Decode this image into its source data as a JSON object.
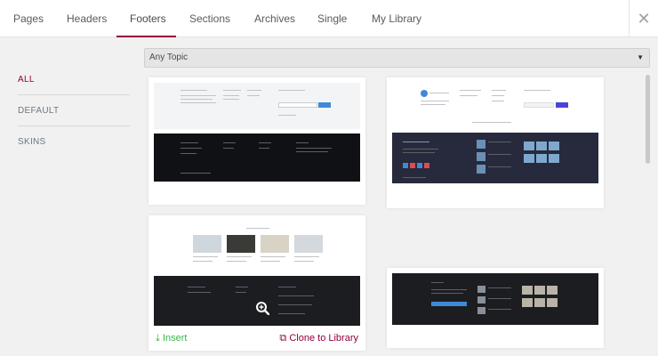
{
  "tabs": [
    {
      "label": "Pages"
    },
    {
      "label": "Headers"
    },
    {
      "label": "Footers"
    },
    {
      "label": "Sections"
    },
    {
      "label": "Archives"
    },
    {
      "label": "Single"
    },
    {
      "label": "My Library"
    }
  ],
  "active_tab": "Footers",
  "close_icon": "close-icon",
  "sidebar": {
    "items": [
      {
        "label": "ALL"
      },
      {
        "label": "DEFAULT"
      },
      {
        "label": "SKINS"
      }
    ],
    "active": "ALL"
  },
  "topic": {
    "value": "Any Topic"
  },
  "card_actions": {
    "insert_label": "Insert",
    "clone_label": "Clone to Library"
  },
  "colors": {
    "accent": "#93003c",
    "insert": "#39b54a"
  }
}
